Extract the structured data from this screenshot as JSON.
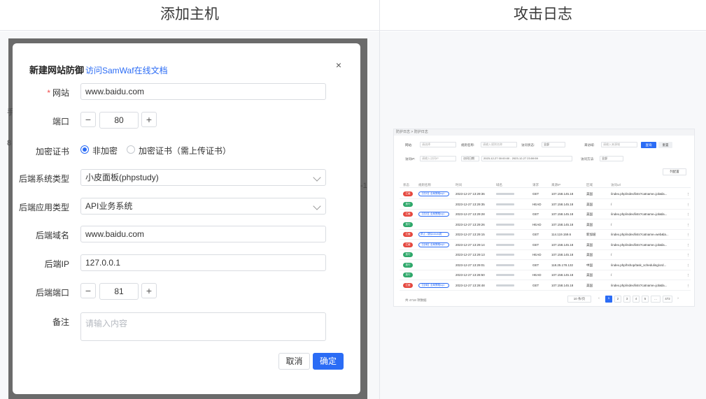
{
  "headers": {
    "left": "添加主机",
    "right": "攻击日志"
  },
  "dialog": {
    "title": "新建网站防御",
    "doc_link": "访问SamWaf在线文档",
    "close_icon": "×",
    "fields": {
      "site": {
        "label": "网站",
        "value": "www.baidu.com"
      },
      "port": {
        "label": "端口",
        "value": "80",
        "minus": "−",
        "plus": "+"
      },
      "ssl": {
        "label": "加密证书",
        "opt1": "非加密",
        "opt2": "加密证书（需上传证书）",
        "selected": "非加密"
      },
      "backend_sys": {
        "label": "后端系统类型",
        "value": "小皮面板(phpstudy)"
      },
      "backend_app": {
        "label": "后端应用类型",
        "value": "API业务系统"
      },
      "backend_domain": {
        "label": "后端域名",
        "value": "www.baidu.com"
      },
      "backend_ip": {
        "label": "后端IP",
        "value": "127.0.0.1"
      },
      "backend_port": {
        "label": "后端端口",
        "value": "81",
        "minus": "−",
        "plus": "+"
      },
      "remark": {
        "label": "备注",
        "placeholder": "请输入内容"
      }
    },
    "cancel": "取消",
    "confirm": "确定"
  },
  "backdrop_ghost": {
    "a": "手",
    "b": "8",
    "c": "-1"
  },
  "attack_log": {
    "breadcrumb": "防护日志  >  防护日志",
    "filters": {
      "site_label": "网站:",
      "site_ph": "请选择",
      "rule_label": "规则名称:",
      "rule_ph": "请输入规则名称",
      "status_label": "访问状态:",
      "status_val": "全部",
      "host_label": "来访域:",
      "host_ph": "请输入来源域",
      "ip_label": "访问IP:",
      "ip_ph": "请输入访问IP",
      "date_label": "访问日期",
      "date_from": "2023-12-27 00:00:00",
      "date_to": "2023-12-27 23:59:59",
      "method_label": "访问方法:",
      "method_val": "全部",
      "search": "查询",
      "reset": "重置",
      "columns": "列配置"
    },
    "columns": [
      "状态",
      "规则名称",
      "时间",
      "域名",
      "请求",
      "来源IP",
      "区域",
      "访问url"
    ],
    "rows": [
      {
        "status": "拦截",
        "color": "#e5483f",
        "rule": "【访问】全局策略sql-i",
        "time": "2023-12-27 13:29:36",
        "method": "GET",
        "ip": "107.158.145.18",
        "region": "美国",
        "url": "/index.php/index/lists?catname=job&la..."
      },
      {
        "status": "放行",
        "color": "#2ea86a",
        "rule": "",
        "time": "2023-12-27 13:29:35",
        "method": "HEAD",
        "ip": "107.158.145.18",
        "region": "美国",
        "url": "/"
      },
      {
        "status": "拦截",
        "color": "#e5483f",
        "rule": "【访问】全局策略sql-i",
        "time": "2023-12-27 13:29:28",
        "method": "GET",
        "ip": "107.158.145.18",
        "region": "美国",
        "url": "/index.php/index/lists?catname=job&la..."
      },
      {
        "status": "放行",
        "color": "#2ea86a",
        "rule": "",
        "time": "2023-12-27 13:29:26",
        "method": "HEAD",
        "ip": "107.158.145.18",
        "region": "美国",
        "url": "/"
      },
      {
        "status": "拦截",
        "color": "#e5483f",
        "rule": "禁止 - 疑似robots爬",
        "time": "2023-12-27 13:29:15",
        "method": "GET",
        "ip": "114.119.159.6",
        "region": "新加坡",
        "url": "/index.php/index/lists?catname=web&la..."
      },
      {
        "status": "拦截",
        "color": "#e5483f",
        "rule": "【全局】全局策略sql-i",
        "time": "2023-12-27 13:29:14",
        "method": "GET",
        "ip": "107.158.145.18",
        "region": "美国",
        "url": "/index.php/index/lists?catname=job&la..."
      },
      {
        "status": "放行",
        "color": "#2ea86a",
        "rule": "",
        "time": "2023-12-27 13:29:13",
        "method": "HEAD",
        "ip": "107.158.145.18",
        "region": "美国",
        "url": "/"
      },
      {
        "status": "放行",
        "color": "#2ea86a",
        "rule": "",
        "time": "2023-12-27 13:29:01",
        "method": "GET",
        "ip": "118.25.178.132",
        "region": "中国",
        "url": "/index.php/hshop/task_scheduling/ord..."
      },
      {
        "status": "放行",
        "color": "#2ea86a",
        "rule": "",
        "time": "2023-12-27 13:28:50",
        "method": "HEAD",
        "ip": "107.158.145.18",
        "region": "美国",
        "url": "/"
      },
      {
        "status": "拦截",
        "color": "#e5483f",
        "rule": "【全局】全局策略sql-i",
        "time": "2023-12-27 13:28:48",
        "method": "GET",
        "ip": "107.158.145.18",
        "region": "美国",
        "url": "/index.php/index/lists?catname=job&la..."
      }
    ],
    "total": "共 4718 项数据",
    "page_size": "10 条/页",
    "pages": [
      "1",
      "2",
      "3",
      "4",
      "5",
      "...",
      "472"
    ]
  }
}
